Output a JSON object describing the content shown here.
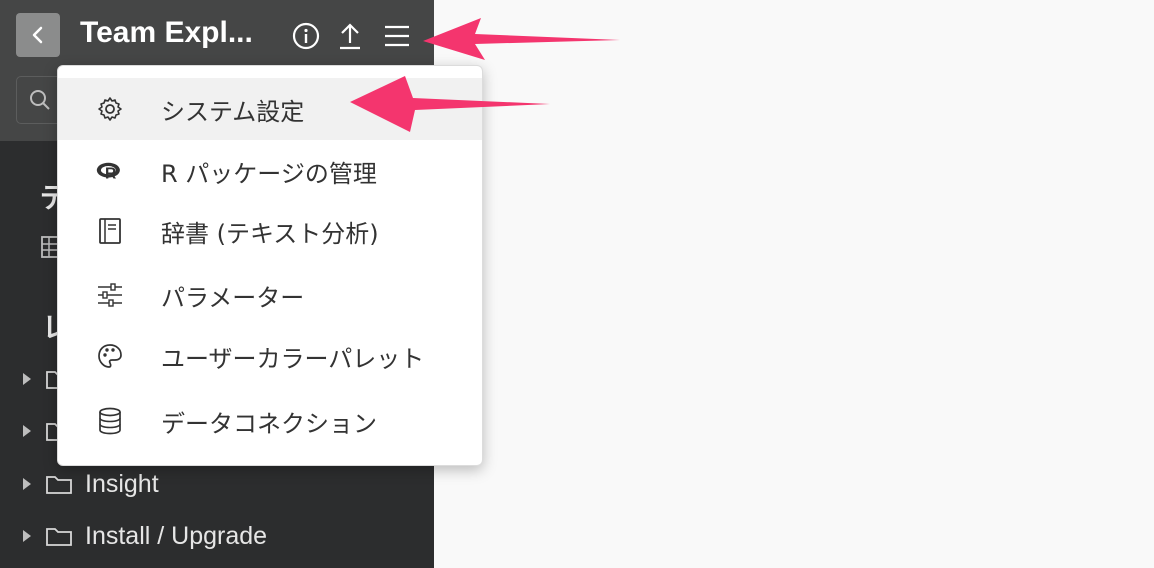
{
  "sidebar": {
    "back_label": "Back",
    "title": "Team Expl...",
    "search_placeholder": "",
    "section1_initial": "デ",
    "section2_initial": "レ",
    "folders": [
      {
        "label": ""
      },
      {
        "label": ""
      },
      {
        "label": "Insight"
      },
      {
        "label": "Install / Upgrade"
      }
    ]
  },
  "header_icons": [
    "info-icon",
    "upload-icon",
    "hamburger-menu-icon"
  ],
  "menu": {
    "items": [
      {
        "icon": "gear-icon",
        "label": "システム設定"
      },
      {
        "icon": "r-logo-icon",
        "label": "R パッケージの管理"
      },
      {
        "icon": "book-icon",
        "label": "辞書 (テキスト分析)"
      },
      {
        "icon": "sliders-icon",
        "label": "パラメーター"
      },
      {
        "icon": "palette-icon",
        "label": "ユーザーカラーパレット"
      },
      {
        "icon": "database-icon",
        "label": "データコネクション"
      }
    ]
  },
  "colors": {
    "sidebar_bg": "#2c2d2e",
    "header_bg": "#454646",
    "annotation_arrow": "#f4356e"
  }
}
